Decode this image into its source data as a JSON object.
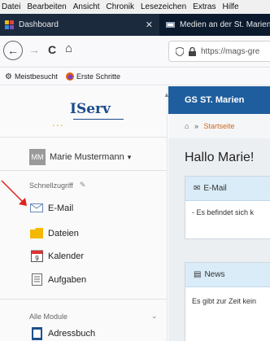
{
  "menubar": [
    "Datei",
    "Bearbeiten",
    "Ansicht",
    "Chronik",
    "Lesezeichen",
    "Extras",
    "Hilfe"
  ],
  "tabs": {
    "active": {
      "title": "Dashboard",
      "close": "✕"
    },
    "inactive": {
      "title": "Medien an der St. Marien Gru"
    }
  },
  "nav": {
    "back": "←",
    "forward": "→",
    "reload": "C",
    "home": "⌂",
    "url": "https://mags-gre"
  },
  "bookmarks": [
    {
      "label": "Meistbesucht",
      "icon": "gear-icon"
    },
    {
      "label": "Erste Schritte",
      "icon": "firefox-icon"
    }
  ],
  "sidebar": {
    "logo": "IServ",
    "user": {
      "initials": "MM",
      "name": "Marie Mustermann",
      "caret": "▾"
    },
    "quick_access": "Schnellzugriff",
    "items": [
      {
        "label": "E-Mail",
        "icon": "mail-icon"
      },
      {
        "label": "Dateien",
        "icon": "folder-icon"
      },
      {
        "label": "Kalender",
        "icon": "calendar-icon",
        "day": "9"
      },
      {
        "label": "Aufgaben",
        "icon": "tasks-icon"
      }
    ],
    "all_modules": "Alle Module",
    "modules": [
      {
        "label": "Adressbuch",
        "icon": "addressbook-icon"
      }
    ]
  },
  "main": {
    "header": "GS ST. Marien",
    "breadcrumb": {
      "sep": "»",
      "link": "Startseite"
    },
    "greeting": "Hallo Marie!",
    "email_card": {
      "title": "E-Mail",
      "body": "- Es befindet sich k"
    },
    "news_card": {
      "title": "News",
      "body": "Es gibt zur Zeit kein"
    }
  },
  "colors": {
    "brand": "#1f5e9e",
    "tabbar": "#0c1a2e",
    "breadcrumb_link": "#d2691e",
    "arrow": "#e0201a"
  }
}
